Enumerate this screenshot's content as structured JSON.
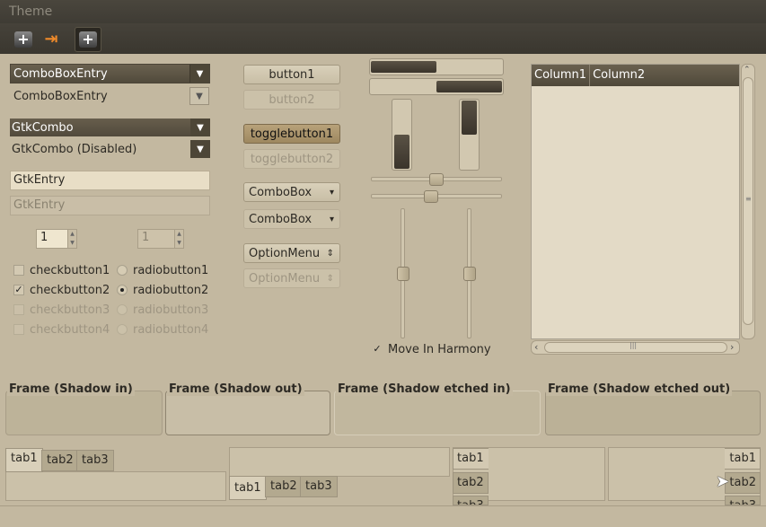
{
  "window": {
    "title": "Theme"
  },
  "toolbar": {
    "buttons": [
      "add-icon",
      "forward-icon",
      "add-icon"
    ]
  },
  "left": {
    "combo_entry_1": "ComboBoxEntry",
    "combo_entry_2": "ComboBoxEntry",
    "gtk_combo": "GtkCombo",
    "gtk_combo_disabled": "GtkCombo (Disabled)",
    "entry": "GtkEntry",
    "entry_disabled": "GtkEntry",
    "spin_1": "1",
    "spin_2": "1",
    "checks": [
      "checkbutton1",
      "checkbutton2",
      "checkbutton3",
      "checkbutton4"
    ],
    "radios": [
      "radiobutton1",
      "radiobutton2",
      "radiobutton3",
      "radiobutton4"
    ]
  },
  "buttons": {
    "button1": "button1",
    "button2": "button2",
    "toggle1": "togglebutton1",
    "toggle2": "togglebutton2",
    "combobox1": "ComboBox",
    "combobox2": "ComboBox",
    "option1": "OptionMenu",
    "option2": "OptionMenu"
  },
  "progress": {
    "h1": 0.5,
    "h2": 0.5,
    "v1": 0.5,
    "v2": 0.5
  },
  "scales": {
    "h1": 0.5,
    "h2": 0.5,
    "v1": 0.5,
    "v2": 0.5
  },
  "harmony": {
    "label": "Move In Harmony",
    "checked": true
  },
  "tree": {
    "columns": [
      "Column1",
      "Column2"
    ]
  },
  "frames": [
    "Frame (Shadow in)",
    "Frame (Shadow out)",
    "Frame (Shadow etched in)",
    "Frame (Shadow etched out)"
  ],
  "tabs": [
    "tab1",
    "tab2",
    "tab3"
  ]
}
